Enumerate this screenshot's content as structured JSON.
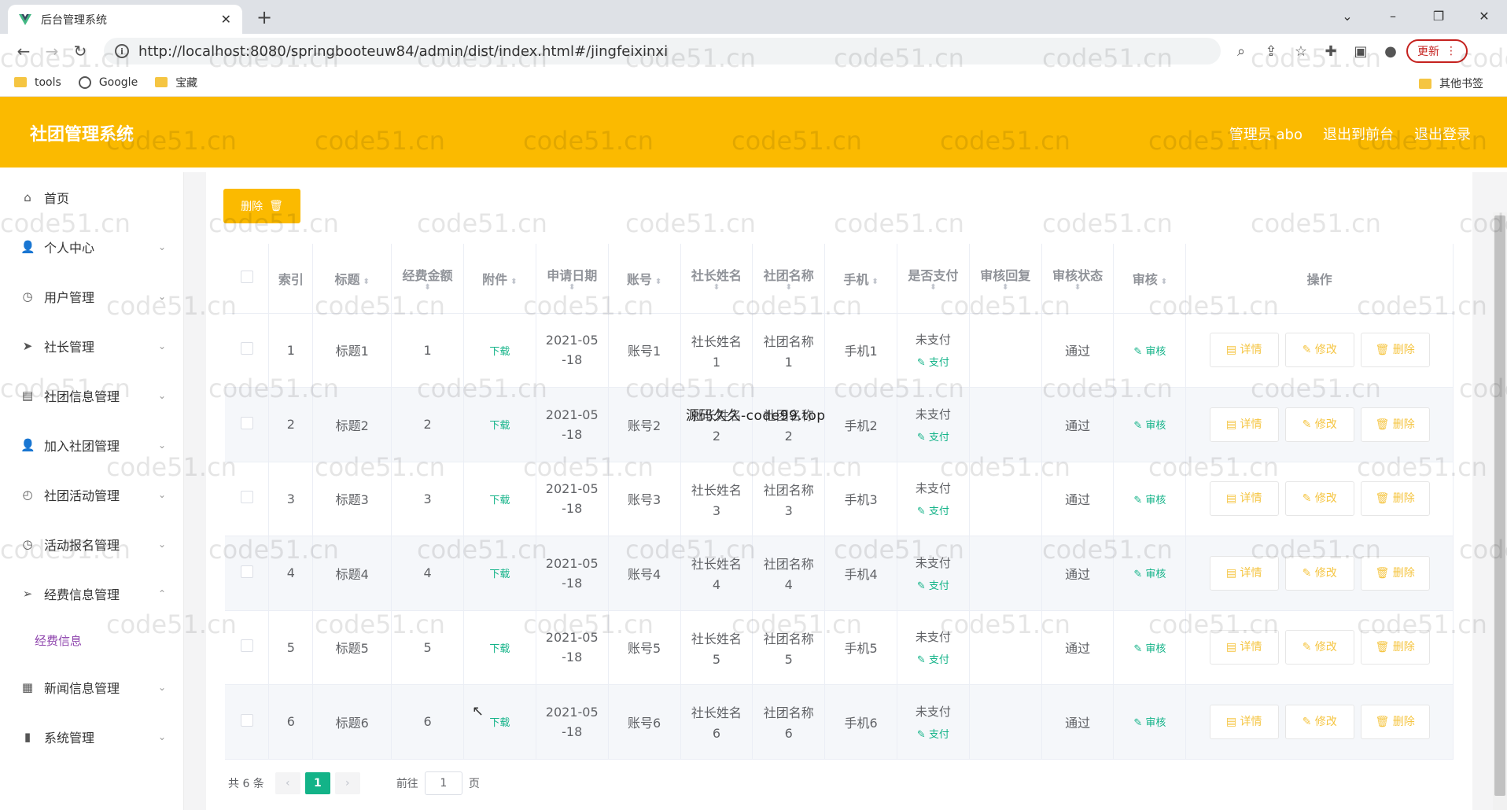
{
  "browser": {
    "tab_title": "后台管理系统",
    "tab_close": "✕",
    "new_tab": "+",
    "url": "http://localhost:8080/springbooteuw84/admin/dist/index.html#/jingfeixinxi",
    "update_label": "更新",
    "window_controls": [
      "⌄",
      "–",
      "❐",
      "✕"
    ]
  },
  "bookmarks": [
    {
      "label": "tools",
      "icon": "folder-icon"
    },
    {
      "label": "Google",
      "icon": "globe-icon"
    },
    {
      "label": "宝藏",
      "icon": "folder-icon"
    }
  ],
  "other_bookmarks": "其他书签",
  "header": {
    "title": "社团管理系统",
    "admin": "管理员 abo",
    "back_front": "退出到前台",
    "logout": "退出登录"
  },
  "sidebar": {
    "items": [
      {
        "label": "首页",
        "icon": "home-icon",
        "glyph": "⌂"
      },
      {
        "label": "个人中心",
        "icon": "user-icon",
        "glyph": "👤",
        "chevron": "⌄"
      },
      {
        "label": "用户管理",
        "icon": "clock-icon",
        "glyph": "◷",
        "chevron": "⌄"
      },
      {
        "label": "社长管理",
        "icon": "send-icon",
        "glyph": "➤",
        "chevron": "⌄"
      },
      {
        "label": "社团信息管理",
        "icon": "doc-icon",
        "glyph": "▤",
        "chevron": "⌄"
      },
      {
        "label": "加入社团管理",
        "icon": "user-icon",
        "glyph": "👤",
        "chevron": "⌄"
      },
      {
        "label": "社团活动管理",
        "icon": "compass-icon",
        "glyph": "◴",
        "chevron": "⌄"
      },
      {
        "label": "活动报名管理",
        "icon": "compass-icon",
        "glyph": "◷",
        "chevron": "⌄"
      },
      {
        "label": "经费信息管理",
        "icon": "send-icon",
        "glyph": "➢",
        "chevron": "⌃"
      }
    ],
    "sub_item": "经费信息",
    "items_after": [
      {
        "label": "新闻信息管理",
        "icon": "news-icon",
        "glyph": "▦",
        "chevron": "⌄"
      },
      {
        "label": "系统管理",
        "icon": "chart-icon",
        "glyph": "▮",
        "chevron": "⌄"
      }
    ]
  },
  "toolbar": {
    "delete_label": "删除",
    "delete_icon": "🗑"
  },
  "table": {
    "headers": {
      "index": "索引",
      "title": "标题",
      "amount": "经费金额",
      "attachment": "附件",
      "date": "申请日期",
      "account": "账号",
      "leader": "社长姓名",
      "club": "社团名称",
      "phone": "手机",
      "paid": "是否支付",
      "reply": "审核回复",
      "status": "审核状态",
      "review": "审核",
      "actions": "操作"
    },
    "rows": [
      {
        "index": "1",
        "title": "标题1",
        "amount": "1",
        "attachment": "下载",
        "date_a": "2021-05",
        "date_b": "-18",
        "account": "账号1",
        "leader_a": "社长姓名",
        "leader_b": "1",
        "club_a": "社团名称",
        "club_b": "1",
        "phone": "手机1",
        "paid": "未支付",
        "pay": "支付",
        "reply": "",
        "status": "通过",
        "review": "审核"
      },
      {
        "index": "2",
        "title": "标题2",
        "amount": "2",
        "attachment": "下载",
        "date_a": "2021-05",
        "date_b": "-18",
        "account": "账号2",
        "leader_a": "社长姓名",
        "leader_b": "2",
        "club_a": "社团名称",
        "club_b": "2",
        "phone": "手机2",
        "paid": "未支付",
        "pay": "支付",
        "reply": "",
        "status": "通过",
        "review": "审核"
      },
      {
        "index": "3",
        "title": "标题3",
        "amount": "3",
        "attachment": "下载",
        "date_a": "2021-05",
        "date_b": "-18",
        "account": "账号3",
        "leader_a": "社长姓名",
        "leader_b": "3",
        "club_a": "社团名称",
        "club_b": "3",
        "phone": "手机3",
        "paid": "未支付",
        "pay": "支付",
        "reply": "",
        "status": "通过",
        "review": "审核"
      },
      {
        "index": "4",
        "title": "标题4",
        "amount": "4",
        "attachment": "下载",
        "date_a": "2021-05",
        "date_b": "-18",
        "account": "账号4",
        "leader_a": "社长姓名",
        "leader_b": "4",
        "club_a": "社团名称",
        "club_b": "4",
        "phone": "手机4",
        "paid": "未支付",
        "pay": "支付",
        "reply": "",
        "status": "通过",
        "review": "审核"
      },
      {
        "index": "5",
        "title": "标题5",
        "amount": "5",
        "attachment": "下载",
        "date_a": "2021-05",
        "date_b": "-18",
        "account": "账号5",
        "leader_a": "社长姓名",
        "leader_b": "5",
        "club_a": "社团名称",
        "club_b": "5",
        "phone": "手机5",
        "paid": "未支付",
        "pay": "支付",
        "reply": "",
        "status": "通过",
        "review": "审核"
      },
      {
        "index": "6",
        "title": "标题6",
        "amount": "6",
        "attachment": "下载",
        "date_a": "2021-05",
        "date_b": "-18",
        "account": "账号6",
        "leader_a": "社长姓名",
        "leader_b": "6",
        "club_a": "社团名称",
        "club_b": "6",
        "phone": "手机6",
        "paid": "未支付",
        "pay": "支付",
        "reply": "",
        "status": "通过",
        "review": "审核"
      }
    ],
    "action_labels": {
      "detail": "详情",
      "edit": "修改",
      "delete": "删除"
    }
  },
  "pagination": {
    "total": "共 6 条",
    "prev": "‹",
    "current": "1",
    "next": "›",
    "goto_label": "前往",
    "goto_value": "1",
    "page_unit": "页"
  },
  "overlay_text": "源码久久-code99.top",
  "watermark_text": "code51.cn",
  "colors": {
    "accent": "#fbba00",
    "link": "#13b388",
    "active_sub": "#8e44ad"
  }
}
